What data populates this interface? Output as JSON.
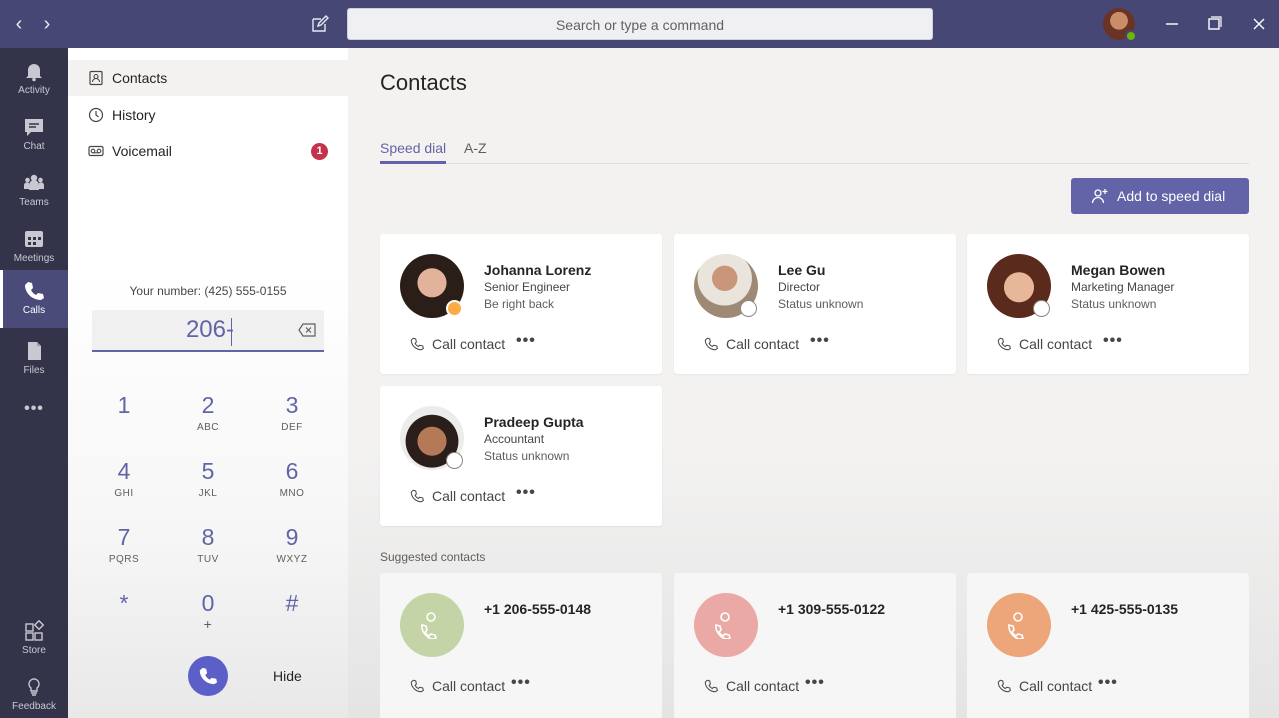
{
  "titlebar": {
    "search_placeholder": "Search or type a command",
    "back_glyph": "‹",
    "forward_glyph": "›"
  },
  "rail": {
    "items": [
      {
        "label": "Activity",
        "icon": "bell-icon"
      },
      {
        "label": "Chat",
        "icon": "chat-icon"
      },
      {
        "label": "Teams",
        "icon": "teams-icon"
      },
      {
        "label": "Meetings",
        "icon": "calendar-icon"
      },
      {
        "label": "Calls",
        "icon": "phone-icon",
        "active": true
      },
      {
        "label": "Files",
        "icon": "file-icon"
      },
      {
        "label": "•••",
        "icon": "more-icon"
      },
      {
        "label": "Store",
        "icon": "store-icon"
      },
      {
        "label": "Feedback",
        "icon": "feedback-icon"
      }
    ]
  },
  "calls_nav": {
    "items": [
      {
        "label": "Contacts",
        "icon": "contacts-icon",
        "active": true
      },
      {
        "label": "History",
        "icon": "clock-icon"
      },
      {
        "label": "Voicemail",
        "icon": "voicemail-icon",
        "badge": "1"
      }
    ]
  },
  "dialer": {
    "your_number": "Your number: (425) 555-0155",
    "input_value": "206-",
    "keys": [
      {
        "digit": "1",
        "letters": ""
      },
      {
        "digit": "2",
        "letters": "ABC"
      },
      {
        "digit": "3",
        "letters": "DEF"
      },
      {
        "digit": "4",
        "letters": "GHI"
      },
      {
        "digit": "5",
        "letters": "JKL"
      },
      {
        "digit": "6",
        "letters": "MNO"
      },
      {
        "digit": "7",
        "letters": "PQRS"
      },
      {
        "digit": "8",
        "letters": "TUV"
      },
      {
        "digit": "9",
        "letters": "WXYZ"
      },
      {
        "digit": "*",
        "letters": ""
      },
      {
        "digit": "0",
        "letters": "+"
      },
      {
        "digit": "#",
        "letters": ""
      }
    ],
    "hide_label": "Hide"
  },
  "main": {
    "title": "Contacts",
    "tabs": [
      {
        "label": "Speed dial",
        "active": true
      },
      {
        "label": "A-Z"
      }
    ],
    "add_button": "Add to speed dial",
    "speed_dial": [
      {
        "name": "Johanna Lorenz",
        "role": "Senior Engineer",
        "status": "Be right back",
        "call_label": "Call contact",
        "more": "•••"
      },
      {
        "name": "Lee Gu",
        "role": "Director",
        "status": "Status unknown",
        "call_label": "Call contact",
        "more": "•••"
      },
      {
        "name": "Megan Bowen",
        "role": "Marketing Manager",
        "status": "Status unknown",
        "call_label": "Call contact",
        "more": "•••"
      },
      {
        "name": "Pradeep Gupta",
        "role": "Accountant",
        "status": "Status unknown",
        "call_label": "Call contact",
        "more": "•••"
      }
    ],
    "suggested_label": "Suggested contacts",
    "suggested": [
      {
        "number": "+1 206-555-0148",
        "call_label": "Call contact",
        "more": "•••",
        "color": "#c5d4a6"
      },
      {
        "number": "+1 309-555-0122",
        "call_label": "Call contact",
        "more": "•••",
        "color": "#eaa9a5"
      },
      {
        "number": "+1 425-555-0135",
        "call_label": "Call contact",
        "more": "•••",
        "color": "#eda57a"
      }
    ]
  },
  "colors": {
    "brand": "#6264a7",
    "titlebar": "#464775",
    "rail": "#33344a",
    "badge": "#c4314b"
  }
}
